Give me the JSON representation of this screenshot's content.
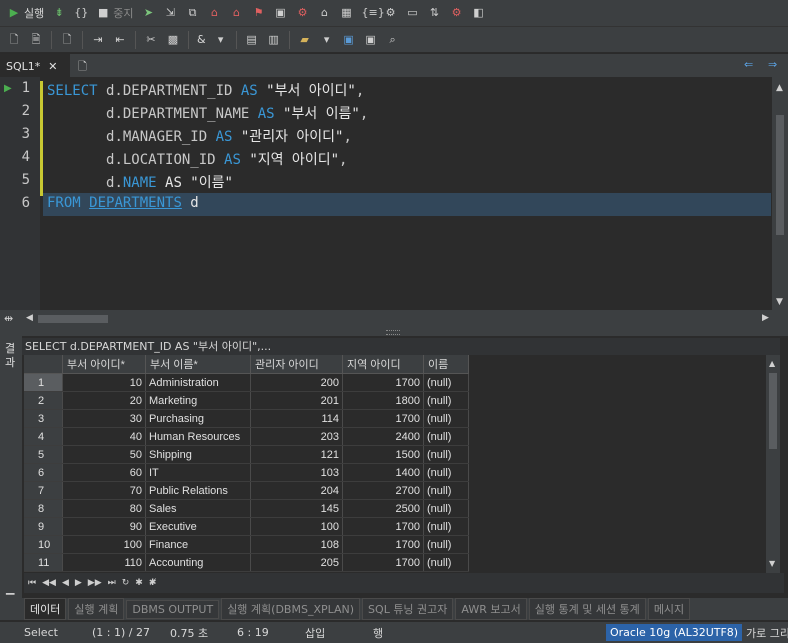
{
  "toolbar": {
    "run_label": "실행",
    "stop_label": "중지",
    "amp_label": "&"
  },
  "editor_tab": {
    "label": "SQL1*"
  },
  "editor": {
    "line_numbers": [
      "1",
      "2",
      "3",
      "4",
      "5",
      "6"
    ],
    "lines": [
      {
        "pre": "",
        "kw1": "SELECT",
        "mid": " d.DEPARTMENT_ID ",
        "kw2": "AS",
        "str": " \"부서 아이디\"",
        "post": ","
      },
      {
        "pre": "       ",
        "kw1": "",
        "mid": "d.DEPARTMENT_NAME ",
        "kw2": "AS",
        "str": " \"부서 이름\"",
        "post": ","
      },
      {
        "pre": "       ",
        "kw1": "",
        "mid": "d.MANAGER_ID ",
        "kw2": "AS",
        "str": " \"관리자 아이디\"",
        "post": ","
      },
      {
        "pre": "       ",
        "kw1": "",
        "mid": "d.LOCATION_ID ",
        "kw2": "AS",
        "str": " \"지역 아이디\"",
        "post": ","
      },
      {
        "pre": "       ",
        "kw1": "",
        "mid": "d.",
        "kw2": "NAME",
        "str": " AS \"이름\"",
        "post": ""
      },
      {
        "pre": "",
        "kw1": "FROM",
        "mid": " ",
        "kw2": "DEPARTMENTS",
        "str": " d",
        "post": ""
      }
    ]
  },
  "result": {
    "side_label": "결과",
    "query_title": "SELECT d.DEPARTMENT_ID AS \"부서 아이디\",...",
    "columns": [
      "부서 아이디*",
      "부서 이름*",
      "관리자 아이디",
      "지역 아이디",
      "이름"
    ],
    "rows": [
      [
        "1",
        "10",
        "Administration",
        "200",
        "1700",
        "(null)"
      ],
      [
        "2",
        "20",
        "Marketing",
        "201",
        "1800",
        "(null)"
      ],
      [
        "3",
        "30",
        "Purchasing",
        "114",
        "1700",
        "(null)"
      ],
      [
        "4",
        "40",
        "Human Resources",
        "203",
        "2400",
        "(null)"
      ],
      [
        "5",
        "50",
        "Shipping",
        "121",
        "1500",
        "(null)"
      ],
      [
        "6",
        "60",
        "IT",
        "103",
        "1400",
        "(null)"
      ],
      [
        "7",
        "70",
        "Public Relations",
        "204",
        "2700",
        "(null)"
      ],
      [
        "8",
        "80",
        "Sales",
        "145",
        "2500",
        "(null)"
      ],
      [
        "9",
        "90",
        "Executive",
        "100",
        "1700",
        "(null)"
      ],
      [
        "10",
        "100",
        "Finance",
        "108",
        "1700",
        "(null)"
      ],
      [
        "11",
        "110",
        "Accounting",
        "205",
        "1700",
        "(null)"
      ]
    ]
  },
  "bottom_tabs": [
    "데이터",
    "실행 계획",
    "DBMS OUTPUT",
    "실행 계획(DBMS_XPLAN)",
    "SQL 튜닝 권고자",
    "AWR 보고서",
    "실행 통계 및 세션 통계",
    "메시지"
  ],
  "status": {
    "mode": "Select",
    "position": "(1 : 1) / 27",
    "time": "0.75 초",
    "caret": "6 : 19",
    "insert": "삽입",
    "unit": "행",
    "connection": "Oracle 10g (AL32UTF8)",
    "layout": "가로 그리"
  },
  "colors": {
    "keyword": "#3a97d6",
    "change_marker": "#c8c832",
    "connection_badge": "#2c63a8"
  }
}
